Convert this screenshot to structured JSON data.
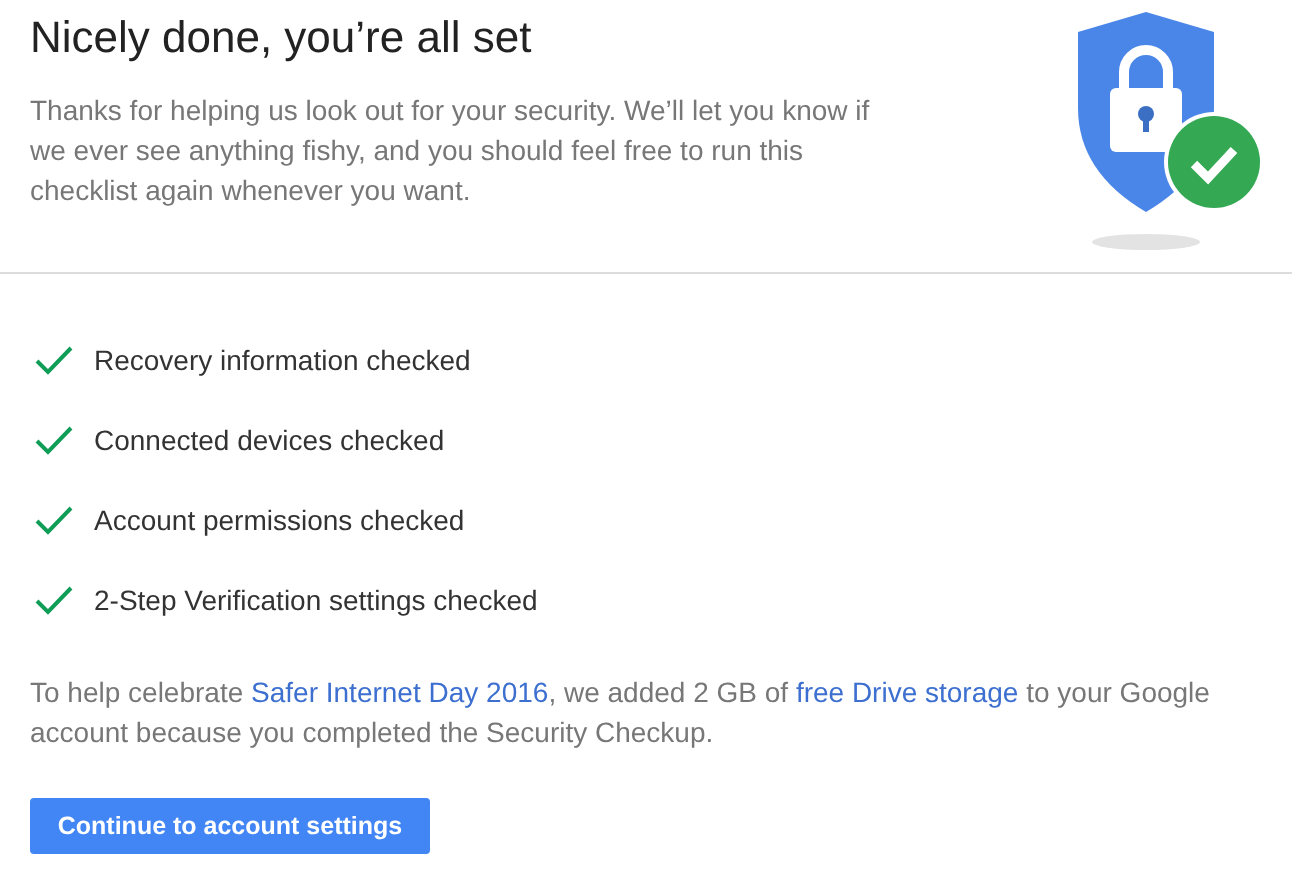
{
  "header": {
    "title": "Nicely done, you’re all set",
    "description": "Thanks for helping us look out for your security. We’ll let you know if we ever see anything fishy, and you should feel free to run this checklist again whenever you want."
  },
  "checklist": [
    {
      "label": "Recovery information checked",
      "checked": true
    },
    {
      "label": "Connected devices checked",
      "checked": true
    },
    {
      "label": "Account permissions checked",
      "checked": true
    },
    {
      "label": "2-Step Verification settings checked",
      "checked": true
    }
  ],
  "note": [
    {
      "kind": "text",
      "text": "To help celebrate "
    },
    {
      "kind": "link",
      "text": "Safer Internet Day 2016"
    },
    {
      "kind": "text",
      "text": ", we added 2 GB of "
    },
    {
      "kind": "link",
      "text": "free Drive storage"
    },
    {
      "kind": "text",
      "text": " to your Google account because you completed the Security Checkup."
    }
  ],
  "button": {
    "label": "Continue to account settings"
  }
}
